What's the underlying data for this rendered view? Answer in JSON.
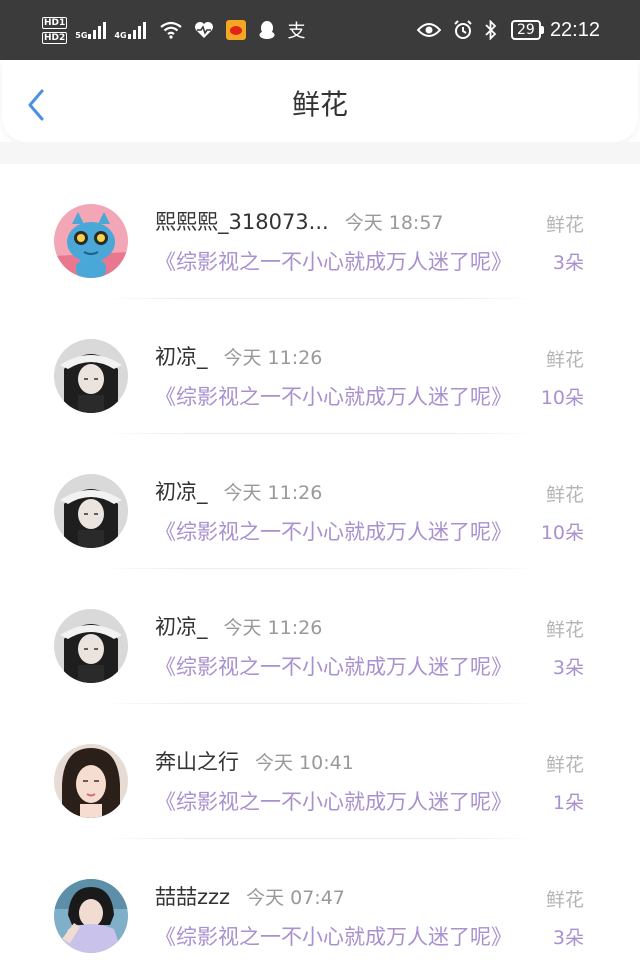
{
  "status_bar": {
    "hd1": "HD1",
    "hd2": "HD2",
    "net1": "5G",
    "net2": "4G",
    "battery": "29",
    "time": "22:12",
    "icons": [
      "wifi-icon",
      "heart-rate-icon",
      "weibo-icon",
      "qq-penguin-icon",
      "zhi-icon",
      "eye-icon",
      "alarm-icon",
      "bluetooth-icon"
    ]
  },
  "header": {
    "title": "鲜花",
    "back_icon": "chevron-left-icon"
  },
  "colors": {
    "accent_purple": "#a990cf",
    "back_blue": "#4a90e2",
    "status_bar_bg": "#3b3b3b"
  },
  "records": [
    {
      "name": "熙熙熙_318073...",
      "time": "今天 18:57",
      "book": "《综影视之一不小心就成万人迷了呢》",
      "gift": "鲜花",
      "count": "3朵"
    },
    {
      "name": "初凉_",
      "time": "今天 11:26",
      "book": "《综影视之一不小心就成万人迷了呢》",
      "gift": "鲜花",
      "count": "10朵"
    },
    {
      "name": "初凉_",
      "time": "今天 11:26",
      "book": "《综影视之一不小心就成万人迷了呢》",
      "gift": "鲜花",
      "count": "10朵"
    },
    {
      "name": "初凉_",
      "time": "今天 11:26",
      "book": "《综影视之一不小心就成万人迷了呢》",
      "gift": "鲜花",
      "count": "3朵"
    },
    {
      "name": "奔山之行",
      "time": "今天 10:41",
      "book": "《综影视之一不小心就成万人迷了呢》",
      "gift": "鲜花",
      "count": "1朵"
    },
    {
      "name": "喆喆zzz",
      "time": "今天 07:47",
      "book": "《综影视之一不小心就成万人迷了呢》",
      "gift": "鲜花",
      "count": "3朵"
    }
  ]
}
